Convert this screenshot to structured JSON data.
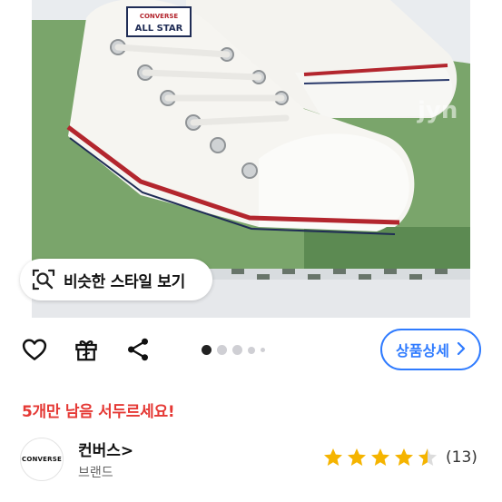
{
  "product_image": {
    "alt": "Converse white low-top sneakers",
    "tongue_label": "ALL STAR",
    "tongue_brand": "CONVERSE",
    "watermark": "jyn"
  },
  "similar_style": {
    "label": "비슷한 스타일 보기",
    "icon": "search-image-icon"
  },
  "actions": {
    "like_icon": "heart-icon",
    "gift_icon": "gift-icon",
    "share_icon": "share-icon"
  },
  "carousel": {
    "total": 5,
    "active_index": 0
  },
  "detail_button": {
    "label": "상품상세",
    "icon": "chevron-right-icon"
  },
  "stock_alert": "5개만 남음 서두르세요!",
  "brand": {
    "logo_text": "CONVERSE",
    "name": "컨버스",
    "name_chevron": ">",
    "subtitle": "브랜드",
    "rating": 4.5,
    "review_count": "(13)"
  },
  "colors": {
    "accent": "#2f7bff",
    "alert": "#e53935",
    "star": "#f5b400"
  }
}
